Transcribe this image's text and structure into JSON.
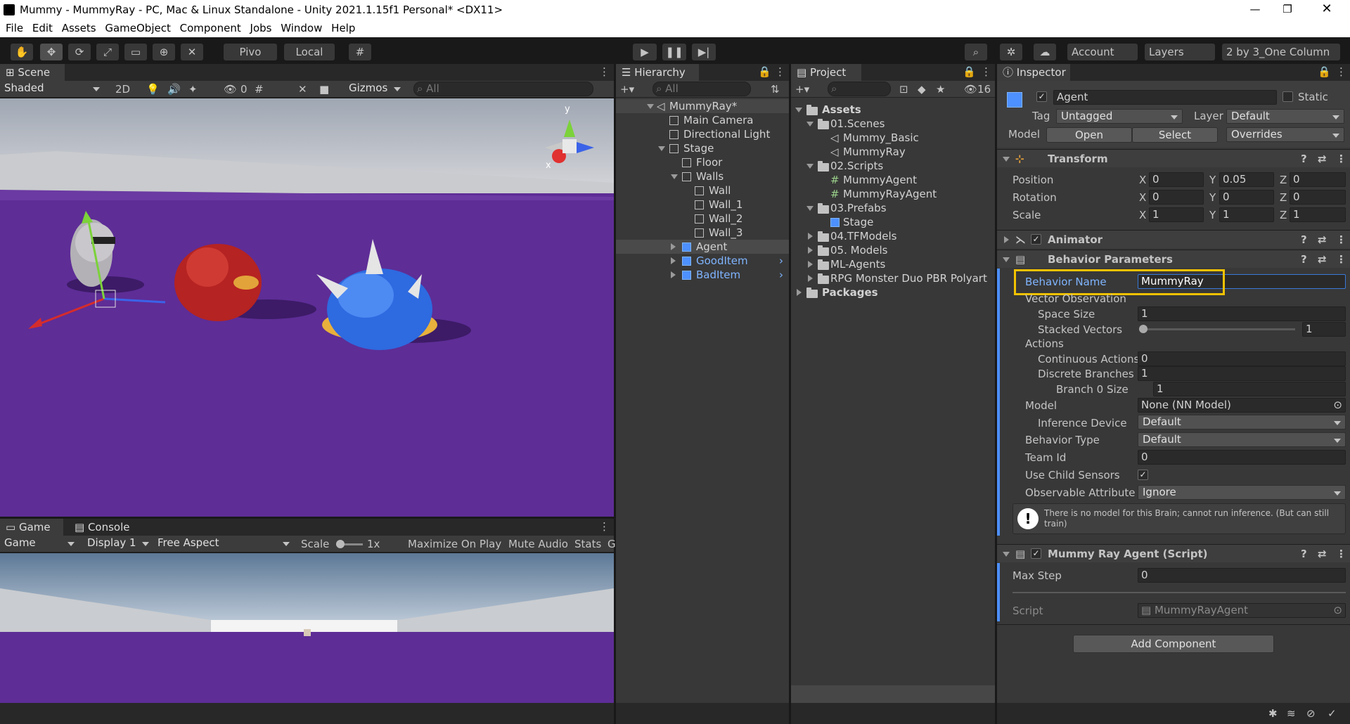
{
  "window": {
    "title": "Mummy - MummyRay - PC, Mac & Linux Standalone - Unity 2021.1.15f1 Personal* <DX11>"
  },
  "menu": [
    "File",
    "Edit",
    "Assets",
    "GameObject",
    "Component",
    "Jobs",
    "Window",
    "Help"
  ],
  "toolbar": {
    "pivot": "Pivo",
    "local": "Local",
    "account": "Account",
    "layers": "Layers",
    "layout": "2 by 3_One Column"
  },
  "scene": {
    "tab": "Scene",
    "shading": "Shaded",
    "mode2d": "2D",
    "hidden_count": "0",
    "gizmos": "Gizmos",
    "search": "All",
    "axis_y": "y",
    "axis_x": "x"
  },
  "game": {
    "tab": "Game",
    "console_tab": "Console",
    "view": "Game",
    "display": "Display 1",
    "aspect": "Free Aspect",
    "scale_label": "Scale",
    "scale_value": "1x",
    "maximize": "Maximize On Play",
    "mute": "Mute Audio",
    "stats": "Stats",
    "more": "G"
  },
  "hierarchy": {
    "tab": "Hierarchy",
    "search": "All",
    "items": [
      "MummyRay*",
      "Main Camera",
      "Directional Light",
      "Stage",
      "Floor",
      "Walls",
      "Wall",
      "Wall_1",
      "Wall_2",
      "Wall_3",
      "Agent",
      "GoodItem",
      "BadItem"
    ]
  },
  "project": {
    "tab": "Project",
    "hidden_count": "16",
    "items": [
      "Assets",
      "01.Scenes",
      "Mummy_Basic",
      "MummyRay",
      "02.Scripts",
      "MummyAgent",
      "MummyRayAgent",
      "03.Prefabs",
      "Stage",
      "04.TFModels",
      "05. Models",
      "ML-Agents",
      "RPG Monster Duo PBR Polyart",
      "Packages"
    ]
  },
  "inspector": {
    "tab": "Inspector",
    "object_name": "Agent",
    "static": "Static",
    "tag_label": "Tag",
    "tag": "Untagged",
    "layer_label": "Layer",
    "layer": "Default",
    "model_label": "Model",
    "open": "Open",
    "select": "Select",
    "overrides": "Overrides",
    "transform": {
      "title": "Transform",
      "position": "Position",
      "rotation": "Rotation",
      "scale": "Scale",
      "pos": [
        "0",
        "0.05",
        "0"
      ],
      "rot": [
        "0",
        "0",
        "0"
      ],
      "scl": [
        "1",
        "1",
        "1"
      ],
      "x": "X",
      "y": "Y",
      "z": "Z"
    },
    "animator": "Animator",
    "behavior": {
      "title": "Behavior Parameters",
      "name_label": "Behavior Name",
      "name_value": "MummyRay",
      "vector_obs": "Vector Observation",
      "space_size_label": "Space Size",
      "space_size": "1",
      "stacked_label": "Stacked Vectors",
      "stacked": "1",
      "actions": "Actions",
      "cont_label": "Continuous Actions",
      "cont": "0",
      "disc_label": "Discrete Branches",
      "disc": "1",
      "branch_label": "Branch 0 Size",
      "branch": "1",
      "model_label": "Model",
      "model": "None (NN Model)",
      "device_label": "Inference Device",
      "device": "Default",
      "type_label": "Behavior Type",
      "type": "Default",
      "team_label": "Team Id",
      "team": "0",
      "child_label": "Use Child Sensors",
      "obs_label": "Observable Attribute H",
      "obs": "Ignore",
      "warning": "There is no model for this Brain; cannot run inference. (But can still train)"
    },
    "agent_script": {
      "title": "Mummy Ray Agent (Script)",
      "max_step_label": "Max Step",
      "max_step": "0",
      "script_label": "Script",
      "script": "MummyRayAgent"
    },
    "add_component": "Add Component"
  },
  "colors": {
    "highlight": "#f2c200",
    "purple": "#5e2d96",
    "selected_blue": "#4d90ff"
  }
}
